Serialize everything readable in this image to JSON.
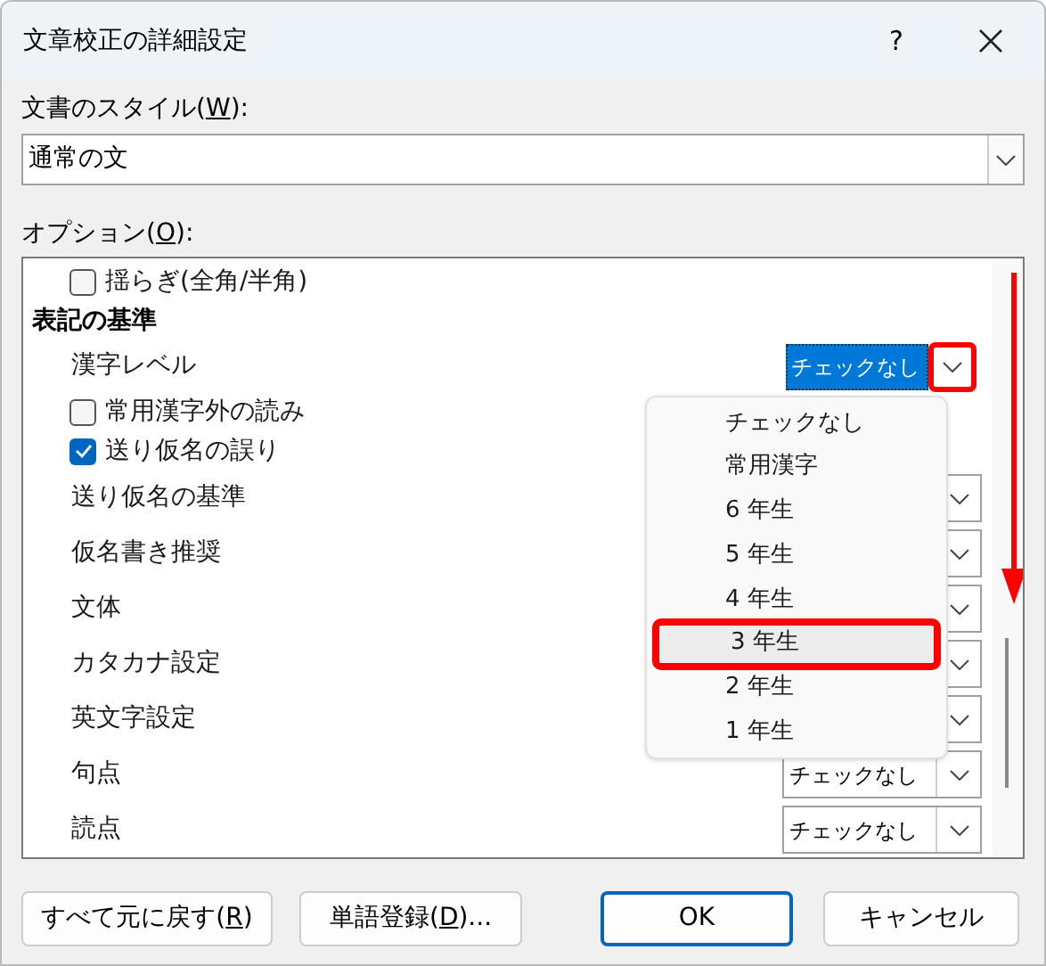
{
  "window": {
    "title": "文章校正の詳細設定",
    "help": "?"
  },
  "style_field": {
    "label": {
      "before": "文書のスタイル(",
      "accel": "W",
      "after": "):"
    },
    "value": "通常の文"
  },
  "options": {
    "label": {
      "before": "オプション(",
      "accel": "O",
      "after": "):"
    },
    "items": [
      {
        "kind": "checkbox",
        "label": "揺らぎ(全角/半角)",
        "checked": false
      },
      {
        "kind": "heading",
        "label": "表記の基準"
      },
      {
        "kind": "active-select",
        "label": "漢字レベル",
        "value": "チェックなし",
        "highlighted": true
      },
      {
        "kind": "checkbox",
        "label": "常用漢字外の読み",
        "checked": false
      },
      {
        "kind": "checkbox",
        "label": "送り仮名の誤り",
        "checked": true
      },
      {
        "kind": "select",
        "label": "送り仮名の基準"
      },
      {
        "kind": "select",
        "label": "仮名書き推奨"
      },
      {
        "kind": "select",
        "label": "文体"
      },
      {
        "kind": "select",
        "label": "カタカナ設定"
      },
      {
        "kind": "select",
        "label": "英文字設定"
      },
      {
        "kind": "select",
        "label": "句点",
        "value": "チェックなし"
      },
      {
        "kind": "select",
        "label": "読点",
        "value": "チェックなし"
      }
    ]
  },
  "dropdown": {
    "items": [
      {
        "label": "チェックなし",
        "selected": false
      },
      {
        "label": "常用漢字",
        "selected": false
      },
      {
        "label": "6 年生",
        "selected": false
      },
      {
        "label": "5 年生",
        "selected": false
      },
      {
        "label": "4 年生",
        "selected": false
      },
      {
        "label": "3 年生",
        "selected": true
      },
      {
        "label": "2 年生",
        "selected": false
      },
      {
        "label": "1 年生",
        "selected": false
      }
    ]
  },
  "buttons": [
    {
      "label": {
        "before": "すべて元に戻す(",
        "accel": "R",
        "after": ")"
      },
      "default": false
    },
    {
      "label": {
        "before": "単語登録(",
        "accel": "D",
        "after": ")..."
      },
      "default": false
    },
    {
      "label": {
        "before": "OK"
      },
      "default": true
    },
    {
      "label": {
        "before": "キャンセル"
      },
      "default": false
    }
  ]
}
